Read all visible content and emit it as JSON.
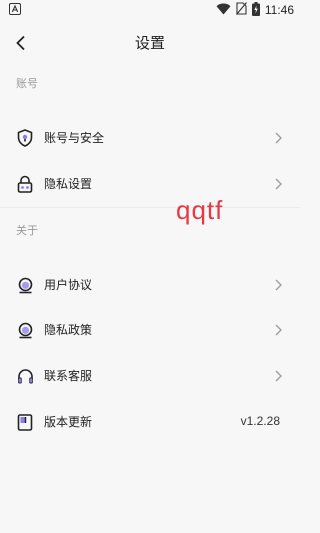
{
  "status_bar": {
    "time": "11:46",
    "icons": [
      "notification-a-icon",
      "wifi-icon",
      "no-sim-icon",
      "battery-charging-icon"
    ]
  },
  "nav": {
    "title": "设置",
    "back_icon": "chevron-left-icon"
  },
  "sections": [
    {
      "label": "账号",
      "items": [
        {
          "label": "账号与安全",
          "icon": "shield-icon",
          "chevron": true
        },
        {
          "label": "隐私设置",
          "icon": "lock-icon",
          "chevron": true
        }
      ]
    },
    {
      "label": "关于",
      "items": [
        {
          "label": "用户协议",
          "icon": "sphere-icon",
          "chevron": true
        },
        {
          "label": "隐私政策",
          "icon": "sphere-icon",
          "chevron": true
        },
        {
          "label": "联系客服",
          "icon": "headset-icon",
          "chevron": true
        },
        {
          "label": "版本更新",
          "icon": "update-box-icon",
          "value": "v1.2.28",
          "chevron": false
        }
      ]
    }
  ],
  "overlay_text": "qqtf",
  "colors": {
    "background": "#f7f7f7",
    "text": "#222222",
    "muted": "#9a9a9a",
    "accent_purple": "#8a7df0",
    "overlay_red": "#e53a44"
  }
}
